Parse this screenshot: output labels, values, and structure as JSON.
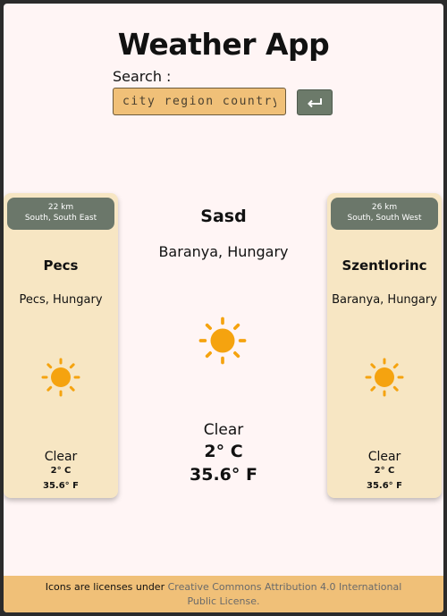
{
  "header": {
    "title": "Weather App"
  },
  "search": {
    "label": "Search :",
    "placeholder": "city region country",
    "submit_icon": "enter-icon"
  },
  "main": {
    "name": "Sasd",
    "region": "Baranya, Hungary",
    "condition": "Clear",
    "temp_c": "2° C",
    "temp_f": "35.6° F",
    "icon": "sun-icon"
  },
  "left_card": {
    "distance": "22 km",
    "direction": "South, South East",
    "name": "Pecs",
    "region": "Pecs, Hungary",
    "condition": "Clear",
    "temp_c": "2° C",
    "temp_f": "35.6° F",
    "icon": "sun-icon"
  },
  "right_card": {
    "distance": "26 km",
    "direction": "South, South West",
    "name": "Szentlorinc",
    "region": "Baranya, Hungary",
    "condition": "Clear",
    "temp_c": "2° C",
    "temp_f": "35.6° F",
    "icon": "sun-icon"
  },
  "footer": {
    "text": "Icons are licenses under",
    "link_text": "Creative Commons Attribution 4.0 International Public License."
  },
  "colors": {
    "page_bg": "#fff5f5",
    "accent": "#f0c078",
    "card_bg": "#f7e6c3",
    "badge_bg": "#6b776a",
    "sun": "#f5a30f"
  }
}
